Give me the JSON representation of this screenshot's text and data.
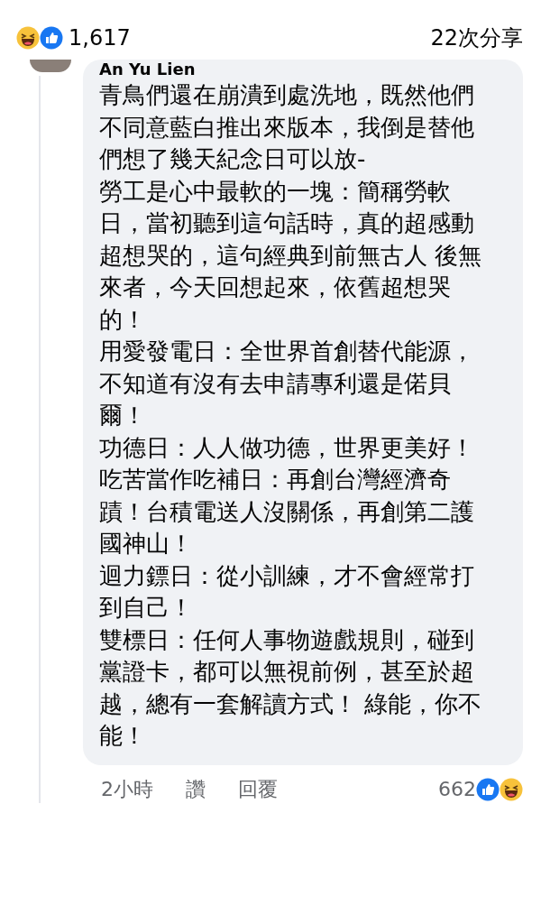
{
  "post_stats": {
    "reactions_count": "1,617",
    "shares": "22次分享"
  },
  "comment": {
    "author": "An Yu Lien",
    "paragraphs": [
      "青鳥們還在崩潰到處洗地，既然他們不同意藍白推出來版本，我倒是替他們想了幾天紀念日可以放-",
      "勞工是心中最軟的一塊：簡稱勞軟日，當初聽到這句話時，真的超感動超想哭的，這句經典到前無古人 後無來者，今天回想起來，依舊超想哭的！",
      "用愛發電日：全世界首創替代能源，不知道有沒有去申請專利還是偌貝爾！",
      "功德日：人人做功德，世界更美好！",
      "吃苦當作吃補日：再創台灣經濟奇蹟！台積電送人沒關係，再創第二護國神山！",
      "迴力鏢日：從小訓練，才不會經常打到自己！",
      "雙標日：任何人事物遊戲規則，碰到黨證卡，都可以無視前例，甚至於超越，總有一套解讀方式！ 綠能，你不能！"
    ],
    "time": "2小時",
    "like": "讚",
    "reply": "回覆",
    "reactions_count": "662"
  }
}
